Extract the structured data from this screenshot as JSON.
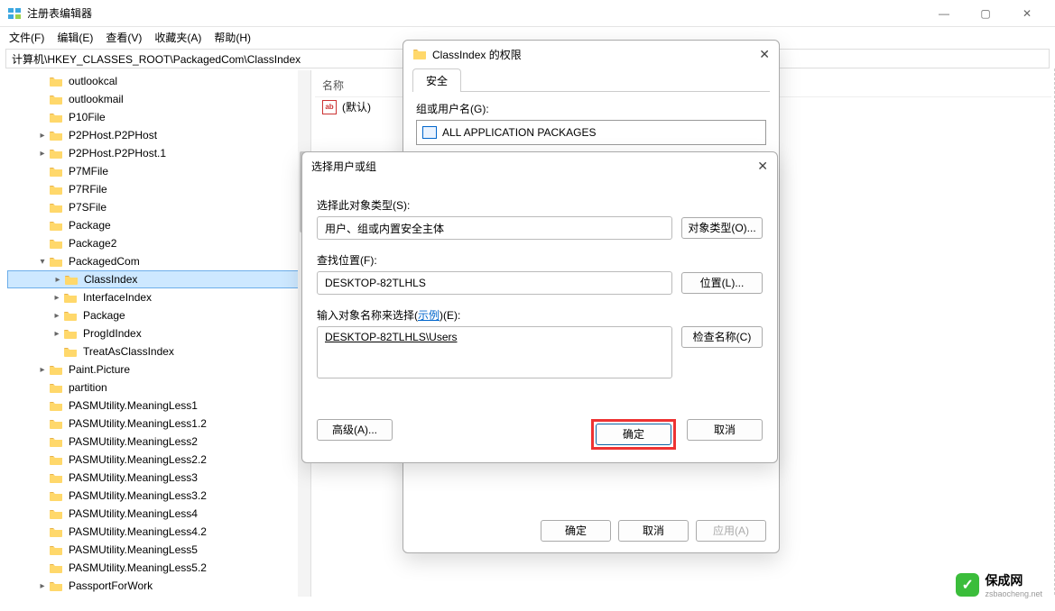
{
  "window": {
    "title": "注册表编辑器",
    "min": "—",
    "max": "▢",
    "close": "✕"
  },
  "menu": {
    "file": "文件(F)",
    "edit": "编辑(E)",
    "view": "查看(V)",
    "fav": "收藏夹(A)",
    "help": "帮助(H)"
  },
  "address": "计算机\\HKEY_CLASSES_ROOT\\PackagedCom\\ClassIndex",
  "tree": [
    {
      "indent": 2,
      "caret": "none",
      "label": "outlookcal"
    },
    {
      "indent": 2,
      "caret": "none",
      "label": "outlookmail"
    },
    {
      "indent": 2,
      "caret": "none",
      "label": "P10File"
    },
    {
      "indent": 2,
      "caret": "closed",
      "label": "P2PHost.P2PHost"
    },
    {
      "indent": 2,
      "caret": "closed",
      "label": "P2PHost.P2PHost.1"
    },
    {
      "indent": 2,
      "caret": "none",
      "label": "P7MFile"
    },
    {
      "indent": 2,
      "caret": "none",
      "label": "P7RFile"
    },
    {
      "indent": 2,
      "caret": "none",
      "label": "P7SFile"
    },
    {
      "indent": 2,
      "caret": "none",
      "label": "Package"
    },
    {
      "indent": 2,
      "caret": "none",
      "label": "Package2"
    },
    {
      "indent": 2,
      "caret": "open",
      "label": "PackagedCom"
    },
    {
      "indent": 3,
      "caret": "closed",
      "label": "ClassIndex",
      "selected": true
    },
    {
      "indent": 3,
      "caret": "closed",
      "label": "InterfaceIndex"
    },
    {
      "indent": 3,
      "caret": "closed",
      "label": "Package"
    },
    {
      "indent": 3,
      "caret": "closed",
      "label": "ProgIdIndex"
    },
    {
      "indent": 3,
      "caret": "none",
      "label": "TreatAsClassIndex"
    },
    {
      "indent": 2,
      "caret": "closed",
      "label": "Paint.Picture"
    },
    {
      "indent": 2,
      "caret": "none",
      "label": "partition"
    },
    {
      "indent": 2,
      "caret": "none",
      "label": "PASMUtility.MeaningLess1"
    },
    {
      "indent": 2,
      "caret": "none",
      "label": "PASMUtility.MeaningLess1.2"
    },
    {
      "indent": 2,
      "caret": "none",
      "label": "PASMUtility.MeaningLess2"
    },
    {
      "indent": 2,
      "caret": "none",
      "label": "PASMUtility.MeaningLess2.2"
    },
    {
      "indent": 2,
      "caret": "none",
      "label": "PASMUtility.MeaningLess3"
    },
    {
      "indent": 2,
      "caret": "none",
      "label": "PASMUtility.MeaningLess3.2"
    },
    {
      "indent": 2,
      "caret": "none",
      "label": "PASMUtility.MeaningLess4"
    },
    {
      "indent": 2,
      "caret": "none",
      "label": "PASMUtility.MeaningLess4.2"
    },
    {
      "indent": 2,
      "caret": "none",
      "label": "PASMUtility.MeaningLess5"
    },
    {
      "indent": 2,
      "caret": "none",
      "label": "PASMUtility.MeaningLess5.2"
    },
    {
      "indent": 2,
      "caret": "closed",
      "label": "PassportForWork"
    }
  ],
  "values": {
    "col_name": "名称",
    "default_name": "(默认)"
  },
  "perm_dialog": {
    "title": "ClassIndex 的权限",
    "tab_security": "安全",
    "group_label": "组或用户名(G):",
    "all_app_pkg": "ALL APPLICATION PACKAGES",
    "ok": "确定",
    "cancel": "取消",
    "apply": "应用(A)"
  },
  "select_dialog": {
    "title": "选择用户或组",
    "obj_type_label": "选择此对象类型(S):",
    "obj_type_value": "用户、组或内置安全主体",
    "obj_type_btn": "对象类型(O)...",
    "location_label": "查找位置(F):",
    "location_value": "DESKTOP-82TLHLS",
    "location_btn": "位置(L)...",
    "names_label_pre": "输入对象名称来选择(",
    "names_label_link": "示例",
    "names_label_post": ")(E):",
    "names_value": "DESKTOP-82TLHLS\\Users",
    "check_btn": "检查名称(C)",
    "advanced": "高级(A)...",
    "ok": "确定",
    "cancel": "取消"
  },
  "watermark": {
    "name": "保成网",
    "url": "zsbaocheng.net"
  }
}
